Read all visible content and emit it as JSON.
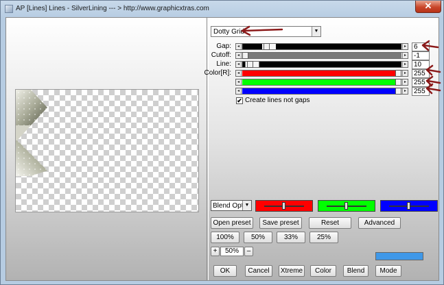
{
  "window": {
    "title": "AP [Lines]  Lines - SilverLining   --- > http://www.graphicxtras.com"
  },
  "preset": {
    "selected": "Dotty Grid"
  },
  "params": [
    {
      "label": "Gap:",
      "value": "6",
      "level": 0.14,
      "color": "#000000"
    },
    {
      "label": "Cutoff:",
      "value": "-1",
      "level": 0.0,
      "color": "#7a7a7a"
    },
    {
      "label": "Line:",
      "value": "10",
      "level": 0.03,
      "color": "#000000"
    },
    {
      "label": "Color[R]:",
      "value": "255",
      "level": 1.0,
      "color": "#ff0000"
    },
    {
      "label": "",
      "value": "255",
      "level": 1.0,
      "color": "#00ff00"
    },
    {
      "label": "",
      "value": "255",
      "level": 1.0,
      "color": "#0000ff"
    }
  ],
  "checkbox": {
    "label": "Create lines not gaps",
    "checked": true,
    "mark": "✔"
  },
  "blend": {
    "selected": "Blend Options",
    "color_boxes": [
      {
        "color": "#ff0000",
        "level": 0.5
      },
      {
        "color": "#00ff00",
        "level": 0.5
      },
      {
        "color": "#0000ff",
        "level": 0.5
      }
    ]
  },
  "buttons": {
    "open_preset": "Open preset",
    "save_preset": "Save preset",
    "reset": "Reset",
    "advanced": "Advanced",
    "zoom_100": "100%",
    "zoom_50": "50%",
    "zoom_33": "33%",
    "zoom_25": "25%",
    "ok": "OK",
    "cancel": "Cancel",
    "xtreme": "Xtreme",
    "color": "Color",
    "blend": "Blend",
    "mode": "Mode"
  },
  "zoom": {
    "plus": "+",
    "value": "50%",
    "minus": "–"
  },
  "icons": {
    "close": "close-icon",
    "dropdown": "chevron-down-icon",
    "arrow": "arrow-annotation-icon"
  },
  "colors": {
    "accent_swatch": "#3f98e8",
    "annotation_arrow": "#8b1a1a",
    "close_button": "#c9472b"
  }
}
